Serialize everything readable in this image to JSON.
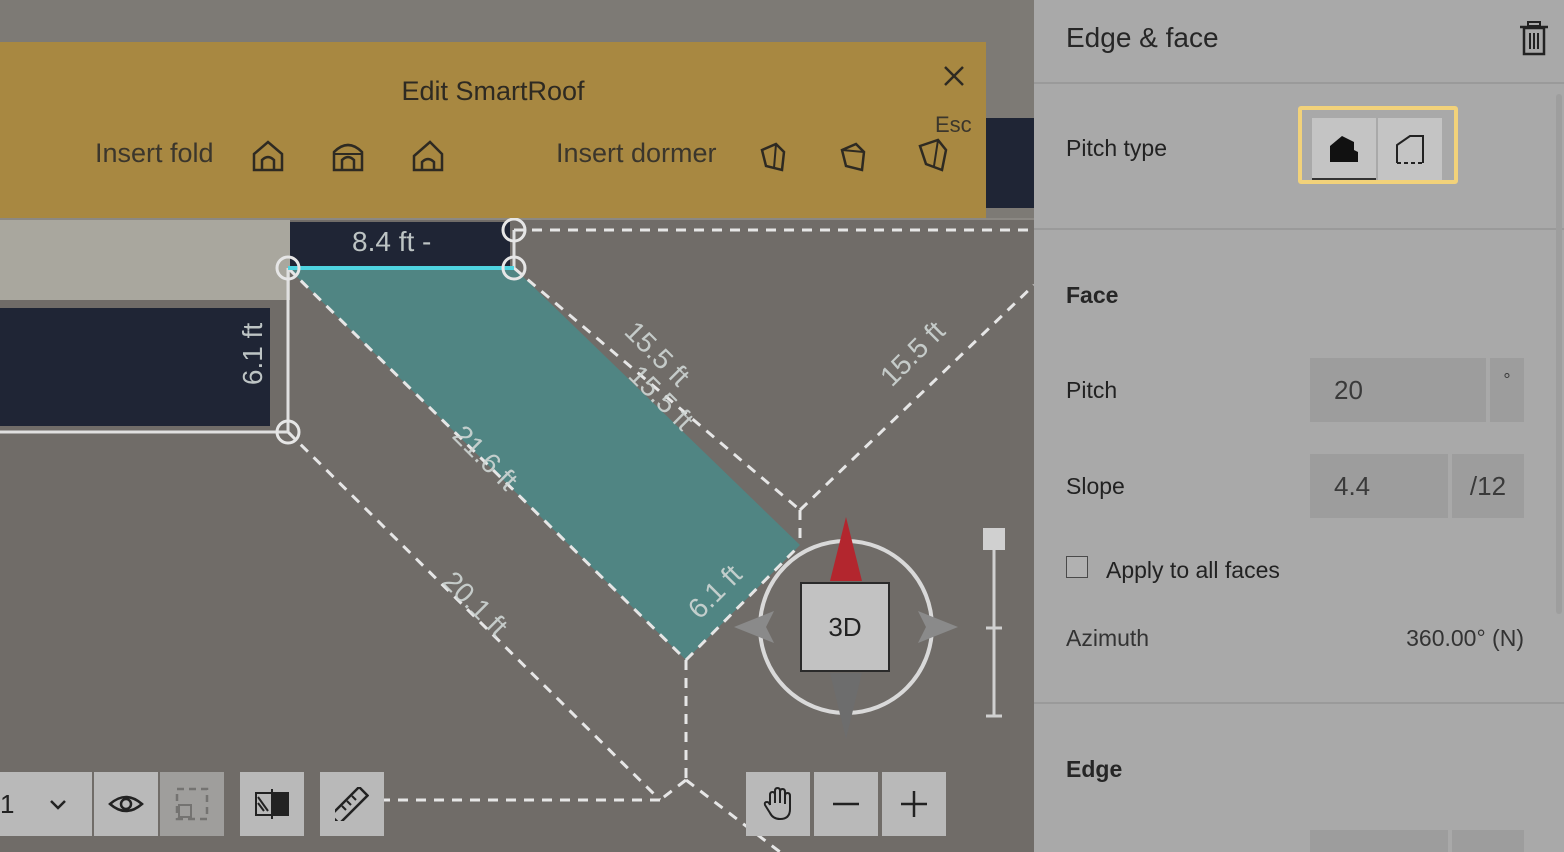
{
  "edit_banner": {
    "title": "Edit SmartRoof",
    "esc_hint": "Esc",
    "insert_fold_label": "Insert fold",
    "insert_dormer_label": "Insert dormer",
    "fold_tools": [
      "gable-fold-icon",
      "hip-fold-icon",
      "shed-fold-icon"
    ],
    "dormer_tools": [
      "gable-dormer-icon",
      "hip-dormer-icon",
      "shed-dormer-icon"
    ]
  },
  "map": {
    "dimension_labels": [
      "8.4 ft -",
      "6.1 ft",
      "15.5 ft",
      "15.5 ft",
      "15.5 ft",
      "21.6 ft",
      "20.1 ft",
      "6.1 ft"
    ],
    "compass_button": "3D",
    "accent_face_color": "#4a8a88",
    "selected_edge_color": "#4fd3e0"
  },
  "toolbar": {
    "layer_value": "1",
    "icons": [
      "chevron-down-icon",
      "eye-icon",
      "select-box-icon",
      "visibility-toggle-icon",
      "ruler-icon"
    ],
    "view_tools": [
      "hand-pan-icon",
      "zoom-out-icon",
      "zoom-in-icon"
    ]
  },
  "panel": {
    "title": "Edge & face",
    "pitch_type_label": "Pitch type",
    "face_section": "Face",
    "pitch_label": "Pitch",
    "pitch_value": "20",
    "pitch_unit": "°",
    "slope_label": "Slope",
    "slope_value": "4.4",
    "slope_unit": "/12",
    "apply_all_label": "Apply to all faces",
    "azimuth_label": "Azimuth",
    "azimuth_value": "360.00° (N)",
    "edge_section": "Edge",
    "highlight_color": "#f2d27a"
  }
}
